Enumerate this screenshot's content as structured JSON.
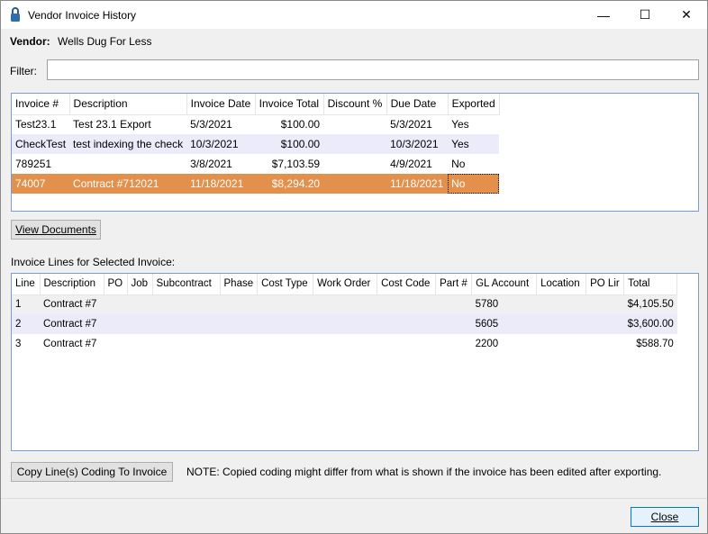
{
  "window": {
    "title": "Vendor Invoice History",
    "minimize": "—",
    "maximize": "☐",
    "close": "✕"
  },
  "vendor": {
    "label": "Vendor:",
    "value": "Wells Dug For Less"
  },
  "filter": {
    "label": "Filter:",
    "value": ""
  },
  "invoices": {
    "columns": [
      "Invoice #",
      "Description",
      "Invoice Date",
      "Invoice Total",
      "Discount %",
      "Due Date",
      "Exported"
    ],
    "rows": [
      [
        "Test23.1",
        "Test 23.1 Export",
        "5/3/2021",
        "$100.00",
        "",
        "5/3/2021",
        "Yes"
      ],
      [
        "CheckTest",
        "test indexing the check",
        "10/3/2021",
        "$100.00",
        "",
        "10/3/2021",
        "Yes"
      ],
      [
        "789251",
        "",
        "3/8/2021",
        "$7,103.59",
        "",
        "4/9/2021",
        "No"
      ],
      [
        "74007",
        "Contract #712021",
        "11/18/2021",
        "$8,294.20",
        "",
        "11/18/2021",
        "No"
      ]
    ],
    "selected_index": 3
  },
  "view_documents": "View Documents",
  "lines_label": "Invoice Lines for Selected Invoice:",
  "lines": {
    "columns": [
      "Line",
      "Description",
      "PO",
      "Job",
      "Subcontract",
      "Phase",
      "Cost Type",
      "Work Order",
      "Cost Code",
      "Part #",
      "GL Account",
      "Location",
      "PO Lir",
      "Total"
    ],
    "rows": [
      [
        "1",
        "Contract #7",
        "",
        "",
        "",
        "",
        "",
        "",
        "",
        "",
        "5780",
        "",
        "",
        "$4,105.50"
      ],
      [
        "2",
        "Contract #7",
        "",
        "",
        "",
        "",
        "",
        "",
        "",
        "",
        "5605",
        "",
        "",
        "$3,600.00"
      ],
      [
        "3",
        "Contract #7",
        "",
        "",
        "",
        "",
        "",
        "",
        "",
        "",
        "2200",
        "",
        "",
        "$588.70"
      ]
    ]
  },
  "copy_button": "Copy Line(s) Coding To Invoice",
  "note": "NOTE: Copied coding might differ from what is shown if the invoice has been edited after exporting.",
  "close_button": "Close",
  "colors": {
    "selection": "#e2904c",
    "alt_row": "#ebebfa",
    "grid_border": "#7a9cd3"
  }
}
